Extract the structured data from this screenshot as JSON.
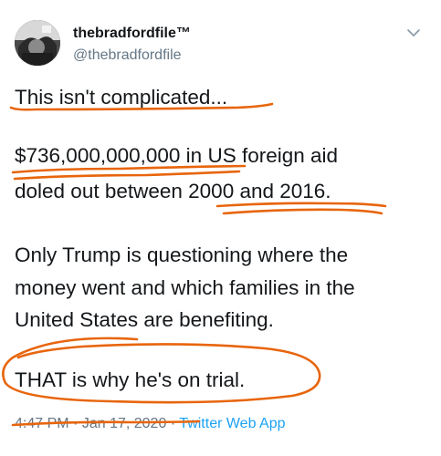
{
  "tweet": {
    "display_name": "thebradfordfile™",
    "handle": "@thebradfordfile",
    "lines": [
      "This isn't complicated...",
      "$736,000,000,000 in US foreign aid",
      "doled out between 2000 and 2016.",
      "Only Trump is questioning where the",
      "money went and which families in the",
      "United States are benefiting.",
      "THAT is why he's on trial."
    ],
    "time": "4:47 PM",
    "separator": "·",
    "date": "Jan 17, 2020",
    "source": "Twitter Web App"
  },
  "icons": {
    "menu": "chevron-down-icon"
  },
  "colors": {
    "annotation": "#e8650c",
    "text": "#14171a",
    "secondary": "#657786",
    "link": "#1da1f2"
  }
}
